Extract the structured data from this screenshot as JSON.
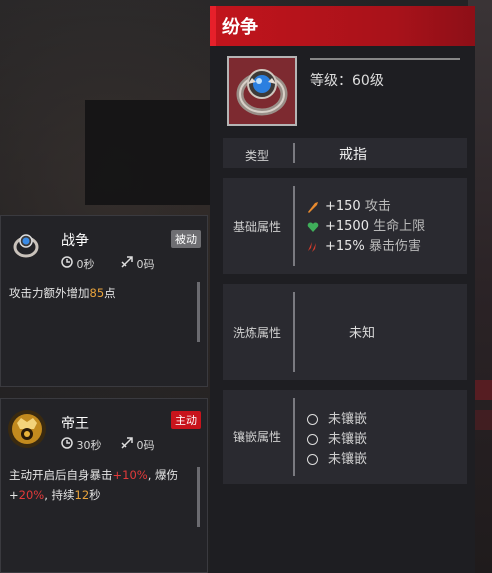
{
  "item": {
    "name": "纷争",
    "level": "等级：60级",
    "type_label": "类型",
    "type_value": "戒指",
    "base_label": "基础属性",
    "base_stats": [
      {
        "icon": "sword-icon",
        "value": "+150",
        "suffix": "攻击",
        "color": "#e88a2e"
      },
      {
        "icon": "heart-icon",
        "value": "+1500",
        "suffix": "生命上限",
        "color": "#3fae5a"
      },
      {
        "icon": "claw-icon",
        "value": "+15%",
        "suffix": "暴击伤害",
        "color": "#d23b2b"
      }
    ],
    "refine_label": "洗炼属性",
    "refine_value": "未知",
    "socket_label": "镶嵌属性",
    "sockets": [
      "未镶嵌",
      "未镶嵌",
      "未镶嵌"
    ]
  },
  "skills": [
    {
      "name": "战争",
      "badge": "被动",
      "badge_color": "#6e6e72",
      "cooldown": "0秒",
      "cost": "0码",
      "desc_a": "攻击力额外增加",
      "desc_val": "85",
      "desc_b": "点"
    },
    {
      "name": "帝王",
      "badge": "主动",
      "badge_color": "#c8141c",
      "cooldown": "30秒",
      "cost": "0码",
      "desc_a": "主动开启后自身暴击",
      "desc_v1": "+10%",
      "desc_b": ", 爆伤+",
      "desc_v2": "20%",
      "desc_c": ", 持续",
      "desc_v3": "12",
      "desc_d": "秒"
    }
  ]
}
